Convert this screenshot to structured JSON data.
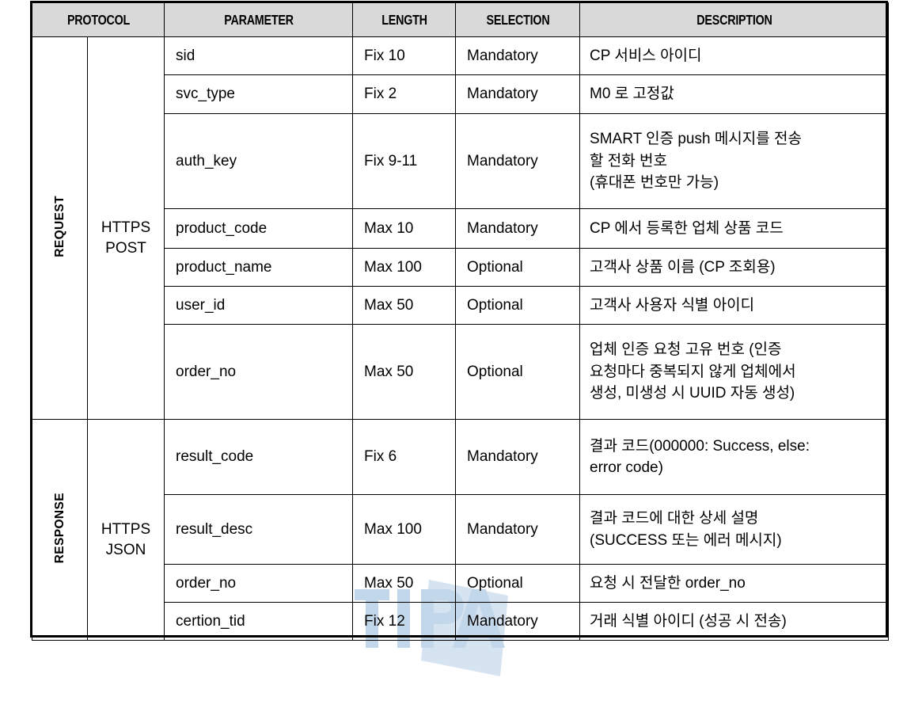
{
  "table": {
    "headers": [
      {
        "label": "PROTOCOL",
        "name": "protocol"
      },
      {
        "label": "PARAMETER",
        "name": "parameter"
      },
      {
        "label": "LENGTH",
        "name": "length"
      },
      {
        "label": "SELECTION",
        "name": "selection"
      },
      {
        "label": "DESCRIPTION",
        "name": "description"
      }
    ],
    "sections": [
      {
        "protocol": "REQUEST",
        "method": "HTTPS\nPOST",
        "rows": [
          {
            "parameter": "sid",
            "length": "Fix 10",
            "selection": "Mandatory",
            "description": "CP 서비스 아이디"
          },
          {
            "parameter": "svc_type",
            "length": "Fix 2",
            "selection": "Mandatory",
            "description": "M0 로 고정값"
          },
          {
            "parameter": "auth_key",
            "length": "Fix 9-11",
            "selection": "Mandatory",
            "description": "SMART 인증 push 메시지를 전송\n할 전화 번호\n(휴대폰 번호만 가능)"
          },
          {
            "parameter": "product_code",
            "length": "Max 10",
            "selection": "Mandatory",
            "description": "CP 에서 등록한 업체 상품 코드"
          },
          {
            "parameter": "product_name",
            "length": "Max 100",
            "selection": "Optional",
            "description": "고객사 상품 이름 (CP 조회용)"
          },
          {
            "parameter": "user_id",
            "length": "Max 50",
            "selection": "Optional",
            "description": "고객사 사용자 식별 아이디"
          },
          {
            "parameter": "order_no",
            "length": "Max 50",
            "selection": "Optional",
            "description": "업체 인증 요청 고유 번호 (인증\n요청마다 중복되지 않게 업체에서\n생성, 미생성 시 UUID 자동 생성)"
          }
        ]
      },
      {
        "protocol": "RESPONSE",
        "method": "HTTPS\nJSON",
        "rows": [
          {
            "parameter": "result_code",
            "length": "Fix 6",
            "selection": "Mandatory",
            "description": "결과 코드(000000: Success, else:\nerror code)"
          },
          {
            "parameter": "result_desc",
            "length": "Max 100",
            "selection": "Mandatory",
            "description": "결과 코드에 대한 상세 설명\n(SUCCESS 또는 에러 메시지)"
          },
          {
            "parameter": "order_no",
            "length": "Max 50",
            "selection": "Optional",
            "description": "요청 시 전달한 order_no"
          },
          {
            "parameter": "certion_tid",
            "length": "Fix 12",
            "selection": "Mandatory",
            "description": "거래 식별 아이디 (성공 시 전송)"
          }
        ]
      }
    ]
  },
  "watermark": {
    "text": "TIPA",
    "color": "#c3d7ea"
  },
  "colors": {
    "header_background": "#d9d9d9",
    "border": "#000000",
    "text": "#000000"
  }
}
